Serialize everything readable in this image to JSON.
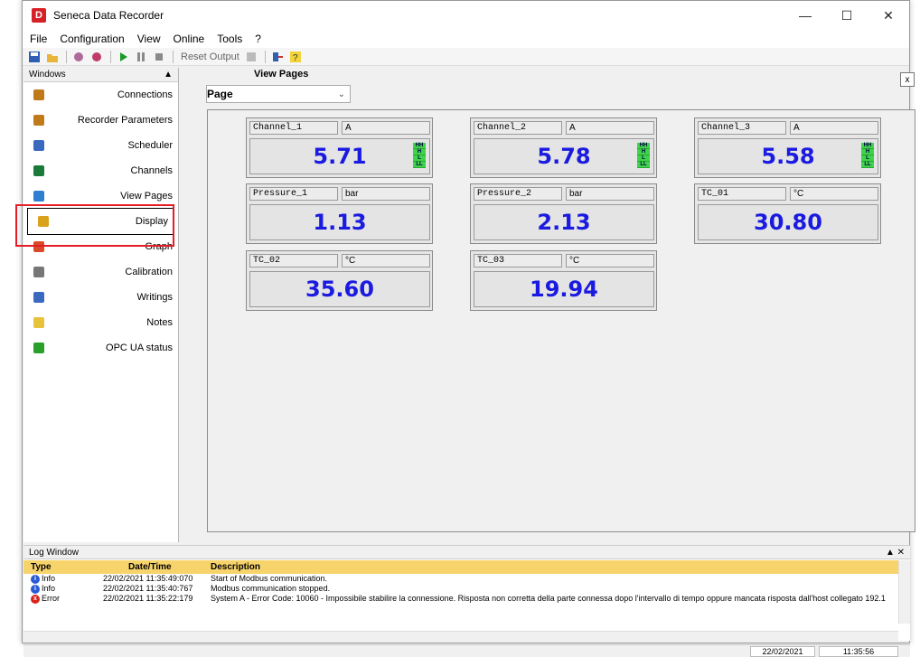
{
  "window": {
    "title": "Seneca Data Recorder",
    "app_icon": "D"
  },
  "menu": [
    "File",
    "Configuration",
    "View",
    "Online",
    "Tools",
    "?"
  ],
  "toolbar": {
    "reset_label": "Reset Output"
  },
  "windows_panel": {
    "title": "Windows",
    "items": [
      {
        "label": "Connections",
        "icon": "connections-icon"
      },
      {
        "label": "Recorder Parameters",
        "icon": "recorder-params-icon"
      },
      {
        "label": "Scheduler",
        "icon": "scheduler-icon"
      },
      {
        "label": "Channels",
        "icon": "channels-icon"
      },
      {
        "label": "View Pages",
        "icon": "view-pages-icon"
      },
      {
        "label": "Display",
        "icon": "display-icon"
      },
      {
        "label": "Graph",
        "icon": "graph-icon"
      },
      {
        "label": "Calibration",
        "icon": "calibration-icon"
      },
      {
        "label": "Writings",
        "icon": "writings-icon"
      },
      {
        "label": "Notes",
        "icon": "notes-icon"
      },
      {
        "label": "OPC UA status",
        "icon": "opc-ua-icon"
      }
    ]
  },
  "view_pages": {
    "title": "View Pages",
    "page_label": "Page",
    "close": "x"
  },
  "channels": [
    {
      "name": "Channel_1",
      "unit": "A",
      "value": "5.71",
      "alarms": [
        "HH",
        "H",
        "L",
        "LL"
      ]
    },
    {
      "name": "Channel_2",
      "unit": "A",
      "value": "5.78",
      "alarms": [
        "HH",
        "H",
        "L",
        "LL"
      ]
    },
    {
      "name": "Channel_3",
      "unit": "A",
      "value": "5.58",
      "alarms": [
        "HH",
        "H",
        "L",
        "LL"
      ]
    },
    {
      "name": "Pressure_1",
      "unit": "bar",
      "value": "1.13",
      "alarms": []
    },
    {
      "name": "Pressure_2",
      "unit": "bar",
      "value": "2.13",
      "alarms": []
    },
    {
      "name": "TC_01",
      "unit": "°C",
      "value": "30.80",
      "alarms": []
    },
    {
      "name": "TC_02",
      "unit": "°C",
      "value": "35.60",
      "alarms": []
    },
    {
      "name": "TC_03",
      "unit": "°C",
      "value": "19.94",
      "alarms": []
    }
  ],
  "log": {
    "title": "Log Window",
    "columns": [
      "Type",
      "Date/Time",
      "Description"
    ],
    "rows": [
      {
        "type": "Info",
        "time": "22/02/2021 11:35:49:070",
        "desc": "Start of Modbus communication."
      },
      {
        "type": "Info",
        "time": "22/02/2021 11:35:40:767",
        "desc": "Modbus communication stopped."
      },
      {
        "type": "Error",
        "time": "22/02/2021 11:35:22:179",
        "desc": "System A - Error Code: 10060 - Impossibile stabilire la connessione. Risposta non corretta della parte connessa dopo l'intervallo di tempo oppure mancata risposta dall'host collegato 192.1"
      }
    ]
  },
  "status": {
    "date": "22/02/2021",
    "time": "11:35:56"
  },
  "colors": {
    "value": "#1a1ae0",
    "alarm": "#3fd24a",
    "highlight": "#e41e26",
    "log_header": "#f7d46b"
  }
}
